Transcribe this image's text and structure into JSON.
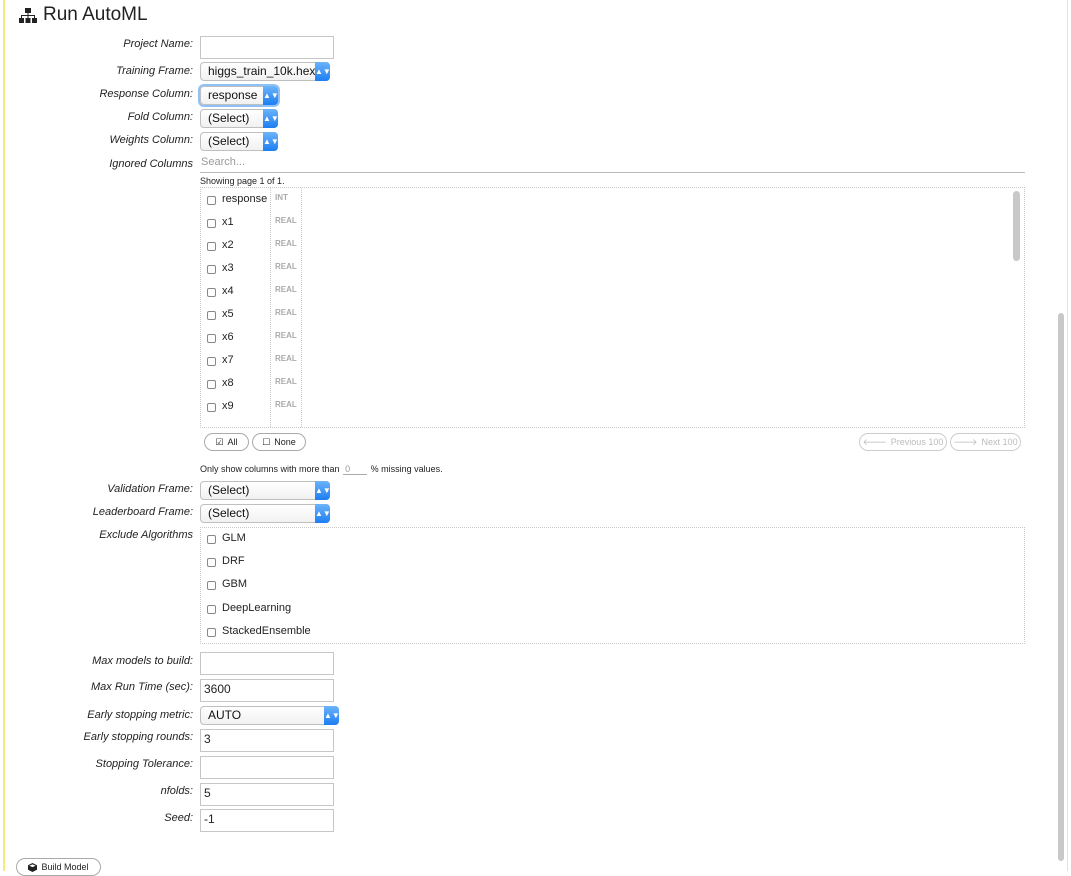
{
  "title": "Run AutoML",
  "form": {
    "project_name": {
      "label": "Project Name:",
      "value": ""
    },
    "training_frame": {
      "label": "Training Frame:",
      "value": "higgs_train_10k.hex"
    },
    "response_column": {
      "label": "Response Column:",
      "value": "response"
    },
    "fold_column": {
      "label": "Fold Column:",
      "value": "(Select)"
    },
    "weights_column": {
      "label": "Weights Column:",
      "value": "(Select)"
    },
    "ignored_columns": {
      "label": "Ignored Columns",
      "search_placeholder": "Search...",
      "page_info": "Showing page 1 of 1.",
      "columns": [
        {
          "name": "response",
          "type": "INT"
        },
        {
          "name": "x1",
          "type": "REAL"
        },
        {
          "name": "x2",
          "type": "REAL"
        },
        {
          "name": "x3",
          "type": "REAL"
        },
        {
          "name": "x4",
          "type": "REAL"
        },
        {
          "name": "x5",
          "type": "REAL"
        },
        {
          "name": "x6",
          "type": "REAL"
        },
        {
          "name": "x7",
          "type": "REAL"
        },
        {
          "name": "x8",
          "type": "REAL"
        },
        {
          "name": "x9",
          "type": "REAL"
        }
      ],
      "all_label": "All",
      "none_label": "None",
      "prev_label": "Previous 100",
      "next_label": "Next 100",
      "missing_prefix": "Only show columns with more than",
      "missing_value": "0",
      "missing_suffix": "% missing values."
    },
    "validation_frame": {
      "label": "Validation Frame:",
      "value": "(Select)"
    },
    "leaderboard_frame": {
      "label": "Leaderboard Frame:",
      "value": "(Select)"
    },
    "exclude_algorithms": {
      "label": "Exclude Algorithms",
      "items": [
        "GLM",
        "DRF",
        "GBM",
        "DeepLearning",
        "StackedEnsemble"
      ]
    },
    "max_models": {
      "label": "Max models to build:",
      "value": ""
    },
    "max_runtime": {
      "label": "Max Run Time (sec):",
      "value": "3600"
    },
    "stopping_metric": {
      "label": "Early stopping metric:",
      "value": "AUTO"
    },
    "stopping_rounds": {
      "label": "Early stopping rounds:",
      "value": "3"
    },
    "stopping_tolerance": {
      "label": "Stopping Tolerance:",
      "value": ""
    },
    "nfolds": {
      "label": "nfolds:",
      "value": "5"
    },
    "seed": {
      "label": "Seed:",
      "value": "-1"
    }
  },
  "build_button": "Build Model",
  "icons": {
    "title": "sitemap-icon",
    "build": "cube-icon"
  }
}
